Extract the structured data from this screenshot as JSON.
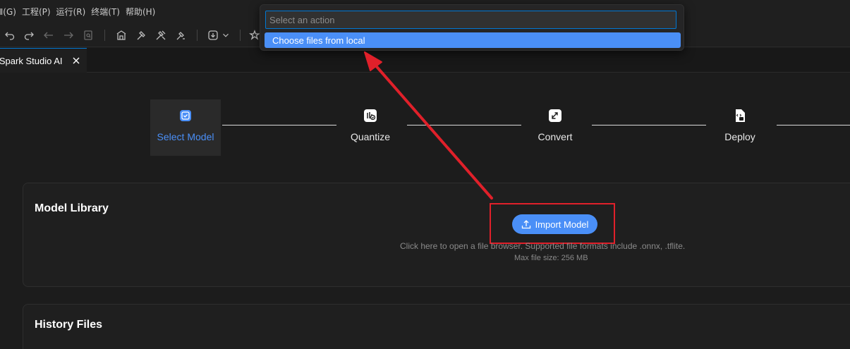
{
  "menubar": {
    "items": [
      "(G)",
      "(P)",
      "(R)",
      "(T)",
      "(H)"
    ],
    "labels": [
      "Ⅲ(G)",
      "工程(P)",
      "运行(R)",
      "终端(T)",
      "帮助(H)"
    ]
  },
  "toolbar": {
    "icons": [
      "undo-icon",
      "redo-icon",
      "back-icon",
      "forward-icon",
      "find-icon",
      "build-icon",
      "hammer-icon",
      "tools-icon",
      "clean-icon",
      "download-icon",
      "chevron-down-icon",
      "debug-icon"
    ]
  },
  "tab": {
    "label": "iSpark Studio AI"
  },
  "stepper": {
    "steps": [
      {
        "label": "Select Model",
        "icon": "checkbox-icon",
        "active": true
      },
      {
        "label": "Quantize",
        "icon": "quantize-icon",
        "active": false
      },
      {
        "label": "Convert",
        "icon": "convert-icon",
        "active": false
      },
      {
        "label": "Deploy",
        "icon": "deploy-icon",
        "active": false
      }
    ]
  },
  "model_library": {
    "title": "Model Library",
    "import_button": "Import Model",
    "hint": "Click here to open a file browser. Supported file formats include .onnx, .tflite.",
    "max_size": "Max file size: 256 MB"
  },
  "history_files": {
    "title": "History Files"
  },
  "command_palette": {
    "placeholder": "Select an action",
    "items": [
      "Choose files from local"
    ]
  },
  "colors": {
    "accent": "#4a8ff7",
    "annotation_red": "#e0202a",
    "focus_border": "#0078d4"
  }
}
